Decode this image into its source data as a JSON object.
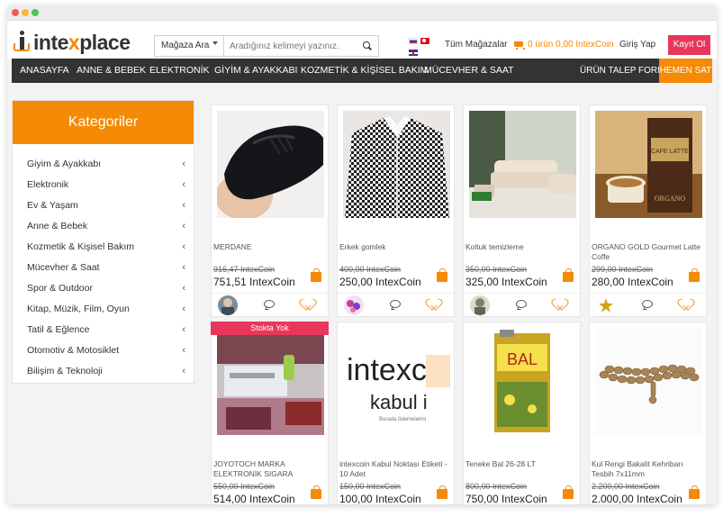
{
  "logo": {
    "part1": "inte",
    "part2": "x",
    "part3": "place"
  },
  "search": {
    "select_label": "Mağaza Ara",
    "placeholder": "Aradığınız kelimeyi yazınız."
  },
  "header": {
    "stores_label": "Tüm Mağazalar",
    "cart_label": "0 ürün 0,00 IntexCoin",
    "login_label": "Giriş Yap",
    "register_label": "Kayıt Ol"
  },
  "nav": {
    "items": [
      "ANASAYFA",
      "ANNE & BEBEK",
      "ELEKTRONİK",
      "GİYİM & AYAKKABI",
      "KOZMETİK & KİŞİSEL BAKIM",
      "MÜCEVHER & SAAT"
    ],
    "request_form": "ÜRÜN TALEP FORMU",
    "cta": "HEMEN SAT"
  },
  "sidebar": {
    "title": "Kategoriler",
    "categories": [
      "Giyim & Ayakkabı",
      "Elektronik",
      "Ev & Yaşam",
      "Anne & Bebek",
      "Kozmetik & Kişisel Bakım",
      "Mücevher & Saat",
      "Spor & Outdoor",
      "Kitap, Müzik, Film, Oyun",
      "Tatil & Eğlence",
      "Otomotiv & Motosiklet",
      "Bilişim & Teknoloji"
    ]
  },
  "products": [
    {
      "name": "MERDANE",
      "old_price": "916,47 IntexCoin",
      "price": "751,51 IntexCoin",
      "image": "shoe"
    },
    {
      "name": "Erkek gomlek",
      "old_price": "400,00 IntexCoin",
      "price": "250,00 IntexCoin",
      "image": "shirt"
    },
    {
      "name": "Koltuk temizleme",
      "old_price": "350,00 IntexCoin",
      "price": "325,00 IntexCoin",
      "image": "sofa"
    },
    {
      "name": "ORGANO GOLD Gourmet Latte Coffe",
      "old_price": "299,00 IntexCoin",
      "price": "280,00 IntexCoin",
      "image": "coffee"
    },
    {
      "name": "JOYOTOCH MARKA ELEKTRONİK SIGARA",
      "old_price": "550,00 IntexCoin",
      "price": "514,00 IntexCoin",
      "image": "ecig",
      "badge": "Stokta Yok"
    },
    {
      "name": "intexcoin Kabul Noktası Etiketi - 10 Adet",
      "old_price": "150,00 IntexCoin",
      "price": "100,00 IntexCoin",
      "image": "sticker"
    },
    {
      "name": "Teneke Bal 26-28 LT",
      "old_price": "800,00 IntexCoin",
      "price": "750,00 IntexCoin",
      "image": "honey"
    },
    {
      "name": "Kul Rengi Bakalit Kehribarı Tesbih 7x11mm",
      "old_price": "2.200,00 IntexCoin",
      "price": "2.000,00 IntexCoin",
      "image": "beads"
    }
  ],
  "sticker": {
    "brand_line1": "intexc",
    "brand_line2": "kabul i",
    "subtitle": "Burada ödemelerini"
  },
  "honey": {
    "label": "BAL"
  },
  "coffee": {
    "label": "CAFE LATTE",
    "brand": "ORGANO"
  },
  "colors": {
    "accent": "#f58a07",
    "nav_bg": "#333333",
    "register": "#e9365a"
  }
}
